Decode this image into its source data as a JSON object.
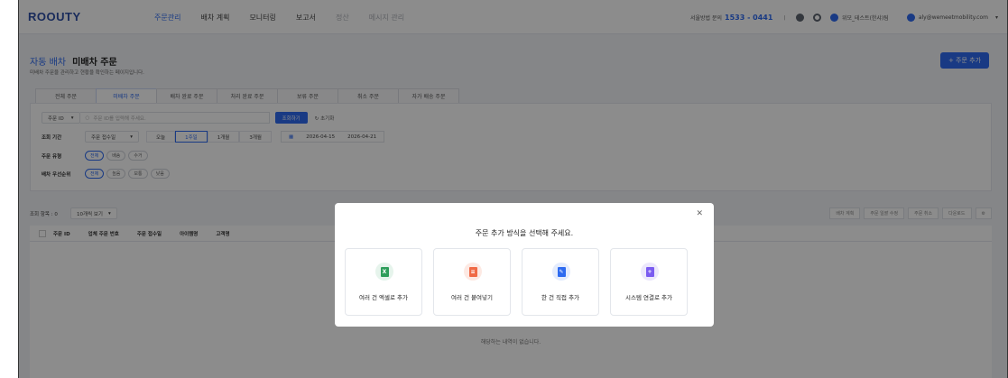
{
  "app": {
    "logo": "ROOUTY"
  },
  "nav": {
    "items": [
      {
        "label": "주문관리",
        "state": "active"
      },
      {
        "label": "배차 계획",
        "state": "normal"
      },
      {
        "label": "모니터링",
        "state": "normal"
      },
      {
        "label": "보고서",
        "state": "normal"
      },
      {
        "label": "정산",
        "state": "dim"
      },
      {
        "label": "메시지 관리",
        "state": "dim"
      }
    ]
  },
  "topbar": {
    "contact_label": "서울방법 문의",
    "phone": "1533 - 0441",
    "separator": "ㅣ",
    "org": "위모_테스트(한샤)팀",
    "user_email": "aly@wemeetmobility.com",
    "dropdown_glyph": "▾"
  },
  "page": {
    "breadcrumb": "자동 배차",
    "title": "미배차 주문",
    "subtitle": "미배차 주문을 관리하고 현황을 확인하는 페이지입니다.",
    "add_button": "+ 주문 추가"
  },
  "tabs": [
    {
      "label": "전체 주문",
      "active": false
    },
    {
      "label": "미배차 주문",
      "active": true
    },
    {
      "label": "배차 완료 주문",
      "active": false
    },
    {
      "label": "처리 완료 주문",
      "active": false
    },
    {
      "label": "보류 주문",
      "active": false
    },
    {
      "label": "취소 주문",
      "active": false
    },
    {
      "label": "자가 배송 주문",
      "active": false
    }
  ],
  "filters": {
    "search_field": "주문 ID",
    "search_placeholder": "주문 ID를 입력해 주세요.",
    "search_button": "조회하기",
    "reset_button": "초기화",
    "period_label": "조회 기간",
    "period_type": "주문 접수일",
    "period_options": [
      {
        "label": "오늘",
        "on": false
      },
      {
        "label": "1주일",
        "on": true
      },
      {
        "label": "1개월",
        "on": false
      },
      {
        "label": "3개월",
        "on": false
      }
    ],
    "date_start": "2026-04-15",
    "date_end": "2026-04-21",
    "type_label": "주문 유형",
    "type_options": [
      {
        "label": "전체",
        "on": true
      },
      {
        "label": "배송",
        "on": false
      },
      {
        "label": "수거",
        "on": false
      }
    ],
    "priority_label": "배차 우선순위",
    "priority_options": [
      {
        "label": "전체",
        "on": true
      },
      {
        "label": "높음",
        "on": false
      },
      {
        "label": "보통",
        "on": false
      },
      {
        "label": "낮음",
        "on": false
      }
    ]
  },
  "list": {
    "count_label": "조회 항목 : 0",
    "per_page": "10개씩 보기",
    "actions": [
      "배차 계획",
      "주문 일괄 수정",
      "주문 취소",
      "다운로드"
    ],
    "columns": [
      "주문 ID",
      "업체 주문 번호",
      "주문 접수일",
      "아이템명",
      "고객명"
    ],
    "empty_text": "해당하는 내역이 없습니다."
  },
  "modal": {
    "title": "주문 추가 방식을 선택해 주세요.",
    "close_glyph": "✕",
    "options": [
      {
        "label": "여러 건 엑셀로 추가",
        "bg": "#e6f4ec",
        "fg": "#2e9e5b",
        "glyph": "X"
      },
      {
        "label": "여러 건 붙여넣기",
        "bg": "#fde9e3",
        "fg": "#f06a46",
        "glyph": "≡"
      },
      {
        "label": "한 건 직접 추가",
        "bg": "#e4ecfd",
        "fg": "#2e6bf0",
        "glyph": "✎"
      },
      {
        "label": "시스템 연결로 추가",
        "bg": "#ece8fc",
        "fg": "#7b5cf0",
        "glyph": "+"
      }
    ]
  }
}
